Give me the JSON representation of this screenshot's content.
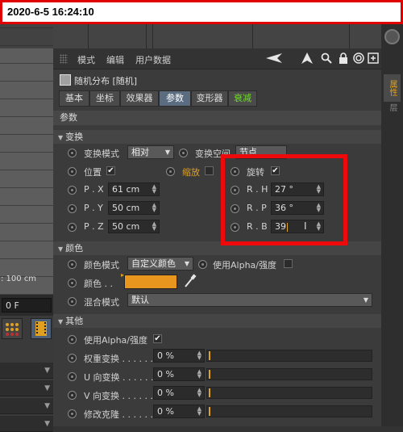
{
  "timestamp": "2020-6-5 16:24:10",
  "viewport": {
    "distance_label": ": 100 cm",
    "frame_value": "0 F"
  },
  "menubar": {
    "items": [
      "模式",
      "编辑",
      "用户数据"
    ]
  },
  "object": {
    "title": "随机分布 [随机]"
  },
  "tabs": [
    {
      "label": "基本"
    },
    {
      "label": "坐标"
    },
    {
      "label": "效果器"
    },
    {
      "label": "参数"
    },
    {
      "label": "变形器"
    },
    {
      "label": "衰减"
    }
  ],
  "param_header": "参数",
  "sections": {
    "transform": "变换",
    "color": "颜色",
    "other": "其他"
  },
  "transform": {
    "mode_label": "变换模式",
    "mode_value": "相对",
    "space_label": "变换空间",
    "space_value": "节点",
    "position_label": "位置",
    "position_check": "✔",
    "scale_label": "缩放",
    "rotation_label": "旋转",
    "rotation_check": "✔",
    "px_label": "P . X",
    "px_value": "61 cm",
    "py_label": "P . Y",
    "py_value": "50 cm",
    "pz_label": "P . Z",
    "pz_value": "50 cm",
    "rh_label": "R . H",
    "rh_value": "27 °",
    "rp_label": "R . P",
    "rp_value": "36 °",
    "rb_label": "R . B",
    "rb_value": "39"
  },
  "color": {
    "mode_label": "颜色模式",
    "mode_value": "自定义颜色",
    "alpha_label": "使用Alpha/强度",
    "color_label": "颜色 . .",
    "swatch": "#e8961e",
    "blend_label": "混合模式",
    "blend_value": "默认"
  },
  "other": {
    "alpha_label": "使用Alpha/强度",
    "alpha_check": "✔",
    "weight_label": "权重变换 . . . . . .",
    "weight_value": "0 %",
    "u_label": "U 向变换 . . . . . .",
    "u_value": "0 %",
    "v_label": "V 向变换 . . . . . .",
    "v_value": "0 %",
    "clone_label": "修改克隆 . . . . . .",
    "clone_value": "0 %"
  },
  "right_tabs": [
    "属性",
    "层"
  ],
  "colors": {
    "accent": "#e0a020",
    "highlight": "#ee0a0a",
    "active_tab": "#5b6c80"
  }
}
